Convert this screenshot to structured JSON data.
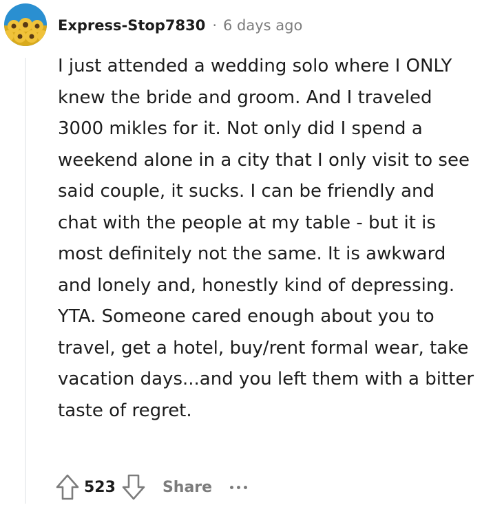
{
  "comment": {
    "author": "Express-Stop7830",
    "separator": "·",
    "timestamp": "6 days ago",
    "avatar_icon": "sunflower-avatar-icon",
    "body": "I just attended a wedding solo where I ONLY knew the bride and groom. And I traveled 3000 mikles for it. Not only did I spend a weekend alone in a city that I only visit to see said couple, it sucks. I can be friendly and chat with the people at my table - but it is most definitely not the same. It is awkward and lonely and, honestly kind of depressing. YTA. Someone cared enough about you to travel, get a hotel, buy/rent formal wear, take vacation days...and you left them with a bitter taste of regret.",
    "score": "523",
    "actions": {
      "upvote_icon": "upvote-arrow-icon",
      "downvote_icon": "downvote-arrow-icon",
      "share_label": "Share",
      "more_icon": "more-options-icon"
    }
  },
  "colors": {
    "text": "#1c1c1c",
    "meta": "#7c7c7c",
    "thread_line": "#edeff1",
    "avatar_bg": "#2a8fd1",
    "avatar_flower": "#e0b21e"
  }
}
